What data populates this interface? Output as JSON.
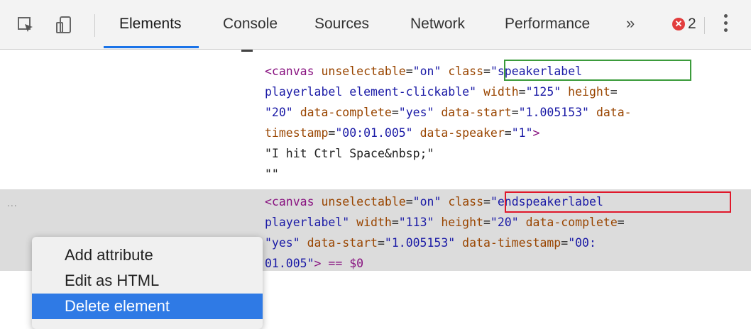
{
  "toolbar": {
    "tabs": [
      {
        "label": "Elements"
      },
      {
        "label": "Console"
      },
      {
        "label": "Sources"
      },
      {
        "label": "Network"
      },
      {
        "label": "Performance"
      }
    ],
    "more": "»",
    "error_count": "2",
    "error_badge": "✕",
    "active_color": "#1a73e8"
  },
  "dom": {
    "line1": {
      "open": "<canvas ",
      "a1": "unselectable",
      "eq": "=",
      "v1": "\"on\"",
      "sp": " ",
      "a2": "class",
      "v2": "\"speakerlabel"
    },
    "line2": {
      "v": "playerlabel element-clickable\"",
      "a1": "width",
      "v1": "\"125\"",
      "a2": "height"
    },
    "line3": {
      "v1": "\"20\"",
      "a1": "data-complete",
      "v2": "\"yes\"",
      "a2": "data-start",
      "v3": "\"1.005153\"",
      "a3": "data-"
    },
    "line4": {
      "a": "timestamp",
      "v1": "\"00:01.005\"",
      "a2": "data-speaker",
      "v2": "\"1\"",
      "close": ">"
    },
    "line5": "\"I hit Ctrl Space&nbsp;\"",
    "line6": "\"\"",
    "line7": {
      "open": "<canvas ",
      "a1": "unselectable",
      "v1": "\"on\"",
      "a2": "class",
      "v2": "\"endspeakerlabel"
    },
    "line8": {
      "v": "playerlabel\"",
      "a1": "width",
      "v1": "\"113\"",
      "a2": "height",
      "v2": "\"20\"",
      "a3": "data-complete"
    },
    "line9": {
      "v1": "\"yes\"",
      "a1": "data-start",
      "v2": "\"1.005153\"",
      "a2": "data-timestamp",
      "v3": "\"00:"
    },
    "line10": {
      "v": "01.005\"",
      "close": "> == $0"
    },
    "dots": "..."
  },
  "context_menu": {
    "items": [
      {
        "label": "Add attribute"
      },
      {
        "label": "Edit as HTML"
      },
      {
        "label": "Delete element"
      }
    ]
  }
}
